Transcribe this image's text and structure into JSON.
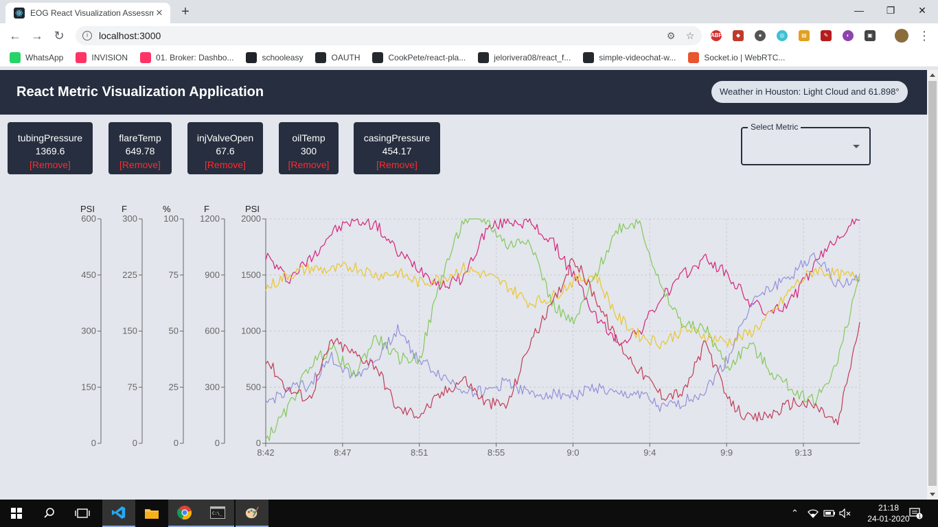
{
  "browser": {
    "tab_title": "EOG React Visualization Assessm",
    "new_tab": "+",
    "url": "localhost:3000",
    "bookmarks": [
      {
        "label": "WhatsApp",
        "icon": "whatsapp-icon",
        "color": "#25d366"
      },
      {
        "label": "INVISION",
        "icon": "invision-icon",
        "color": "#ff3366"
      },
      {
        "label": "01. Broker: Dashbo...",
        "icon": "invision-icon",
        "color": "#ff3366"
      },
      {
        "label": "schooleasy",
        "icon": "react-icon",
        "color": "#20232a"
      },
      {
        "label": "OAUTH",
        "icon": "github-icon",
        "color": "#24292e"
      },
      {
        "label": "CookPete/react-pla...",
        "icon": "github-icon",
        "color": "#24292e"
      },
      {
        "label": "jelorivera08/react_f...",
        "icon": "github-icon",
        "color": "#24292e"
      },
      {
        "label": "simple-videochat-w...",
        "icon": "github-icon",
        "color": "#24292e"
      },
      {
        "label": "Socket.io | WebRTC...",
        "icon": "socketio-icon",
        "color": "#e8552f"
      }
    ]
  },
  "app": {
    "title": "React Metric Visualization Application",
    "weather": "Weather in Houston: Light Cloud and 61.898°",
    "select_label": "Select Metric",
    "remove_label": "[Remove]",
    "cards": [
      {
        "name": "tubingPressure",
        "value": "1369.6"
      },
      {
        "name": "flareTemp",
        "value": "649.78"
      },
      {
        "name": "injValveOpen",
        "value": "67.6"
      },
      {
        "name": "oilTemp",
        "value": "300"
      },
      {
        "name": "casingPressure",
        "value": "454.17"
      }
    ]
  },
  "chart_data": {
    "type": "line",
    "title": "",
    "x_ticks": [
      "8:42",
      "8:47",
      "8:51",
      "8:55",
      "9:0",
      "9:4",
      "9:9",
      "9:13"
    ],
    "axes": [
      {
        "unit": "PSI",
        "ticks": [
          0,
          150,
          300,
          450,
          600
        ],
        "range": [
          0,
          600
        ]
      },
      {
        "unit": "F",
        "ticks": [
          0,
          75,
          150,
          225,
          300
        ],
        "range": [
          0,
          300
        ]
      },
      {
        "unit": "%",
        "ticks": [
          0,
          25,
          50,
          75,
          100
        ],
        "range": [
          0,
          100
        ]
      },
      {
        "unit": "F",
        "ticks": [
          0,
          300,
          600,
          900,
          1200
        ],
        "range": [
          0,
          1200
        ]
      },
      {
        "unit": "PSI",
        "ticks": [
          0,
          500,
          1000,
          1500,
          2000
        ],
        "range": [
          0,
          2000
        ]
      }
    ],
    "grid": true,
    "series": [
      {
        "color": "#d6237c",
        "values": [
          1680,
          1460,
          1640,
          1880,
          1990,
          1950,
          1700,
          1560,
          1400,
          1480,
          1900,
          1990,
          1960,
          1800,
          1500,
          1130,
          900,
          1000,
          1300,
          1500,
          1650,
          1500,
          1260,
          1150,
          1300,
          1600,
          1850,
          1990
        ]
      },
      {
        "color": "#e8c630",
        "values": [
          1380,
          1500,
          1560,
          1540,
          1580,
          1500,
          1520,
          1430,
          1470,
          1560,
          1500,
          1400,
          1250,
          1300,
          1450,
          1500,
          1120,
          960,
          890,
          1020,
          960,
          900,
          980,
          1150,
          1400,
          1550,
          1500,
          1480
        ]
      },
      {
        "color": "#83c85a",
        "values": [
          30,
          300,
          700,
          850,
          600,
          950,
          760,
          750,
          1490,
          1990,
          1990,
          1760,
          1830,
          1250,
          1060,
          1500,
          1920,
          1980,
          1360,
          1050,
          1020,
          670,
          890,
          630,
          470,
          380,
          720,
          1510
        ]
      },
      {
        "color": "#9391d9",
        "values": [
          350,
          480,
          520,
          760,
          600,
          740,
          1020,
          740,
          600,
          480,
          450,
          560,
          430,
          450,
          430,
          500,
          420,
          450,
          300,
          370,
          470,
          750,
          1240,
          1380,
          1520,
          1690,
          1410,
          1460
        ]
      },
      {
        "color": "#c23a56",
        "values": [
          760,
          480,
          400,
          920,
          800,
          700,
          300,
          260,
          440,
          580,
          360,
          340,
          900,
          1220,
          1650,
          1300,
          900,
          650,
          430,
          450,
          900,
          380,
          210,
          260,
          370,
          330,
          170,
          1080
        ]
      }
    ]
  }
}
